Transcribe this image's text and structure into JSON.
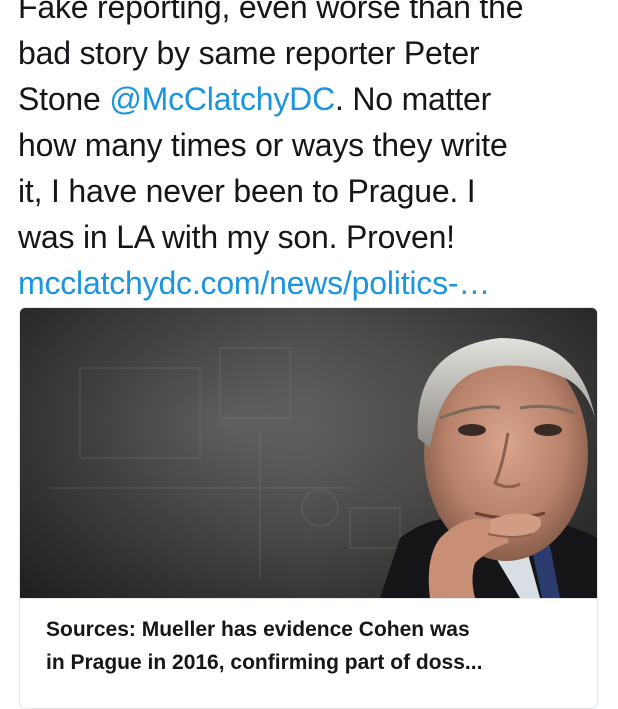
{
  "tweet": {
    "lines": [
      "Fake reporting, even worse than the",
      "bad story by same reporter Peter",
      "Stone ",
      "how many times or ways they write",
      "it, I have never been to Prague. I",
      "was in LA with my son. Proven!",
      "mcclatchydc.com/news/politics-…"
    ],
    "mention": "@McClatchyDC",
    "after_mention": ". No matter"
  },
  "card": {
    "image_alt": "Robert Mueller portrait",
    "title_line1": "Sources: Mueller has evidence Cohen was",
    "title_line2": "in Prague in 2016, confirming part of doss..."
  },
  "colors": {
    "link": "#1b95e0",
    "text": "#14171a",
    "border": "#e1e8ed"
  }
}
